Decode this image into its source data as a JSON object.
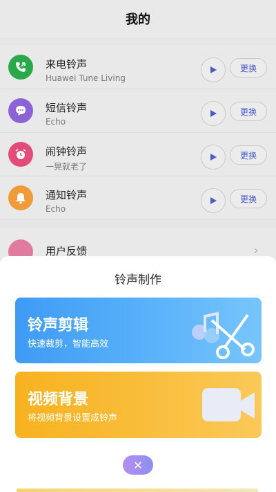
{
  "header": {
    "title": "我的"
  },
  "ringtones": [
    {
      "name": "来电铃声",
      "sub": "Huawei Tune Living",
      "icon": "phone-icon",
      "color": "#2aa84a"
    },
    {
      "name": "短信铃声",
      "sub": "Echo",
      "icon": "message-icon",
      "color": "#8b63d6"
    },
    {
      "name": "闹钟铃声",
      "sub": "一晃就老了",
      "icon": "alarm-clock-icon",
      "color": "#e34c78"
    },
    {
      "name": "通知铃声",
      "sub": "Echo",
      "icon": "bell-icon",
      "color": "#f09a3a"
    }
  ],
  "row_action": {
    "change_label": "更换"
  },
  "feedback": {
    "label": "用户反馈"
  },
  "sheet": {
    "title": "铃声制作",
    "clip_card": {
      "title": "铃声剪辑",
      "subtitle": "快速裁剪，智能高效"
    },
    "video_card": {
      "title": "视频背景",
      "subtitle": "将视频背景设置成铃声"
    },
    "close_label": "✕"
  }
}
